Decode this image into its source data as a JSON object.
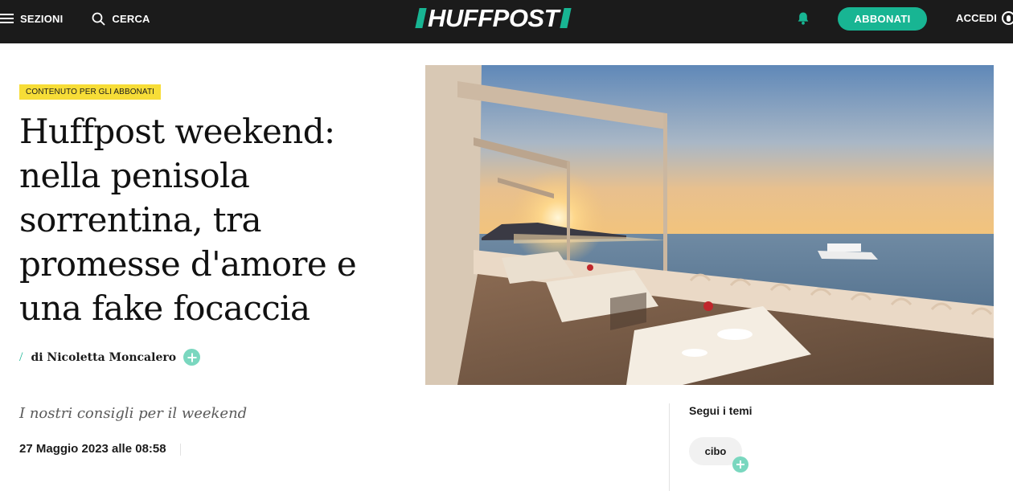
{
  "header": {
    "sections_label": "SEZIONI",
    "search_label": "CERCA",
    "logo_text": "HUFFPOST",
    "subscribe_label": "ABBONATI",
    "login_label": "ACCEDI",
    "icons": [
      "hamburger-menu-icon",
      "search-icon",
      "bell-icon",
      "user-icon"
    ]
  },
  "article": {
    "badge": "CONTENUTO PER GLI ABBONATI",
    "title": "Huffpost weekend: nella penisola sorrentina, tra promesse d'amore e una fake focaccia",
    "byline_slash": "/",
    "author": "di Nicoletta Moncalero",
    "subtitle": "I nostri consigli per il weekend",
    "date": "27 Maggio 2023 alle 08:58"
  },
  "sidebar": {
    "topics_title": "Segui i temi",
    "topics": [
      {
        "label": "cibo"
      }
    ]
  },
  "colors": {
    "topbar_bg": "#1b1b1b",
    "brand_green": "#18b593",
    "badge_yellow": "#f7dd37",
    "follow_mint": "#7ad7bf"
  }
}
